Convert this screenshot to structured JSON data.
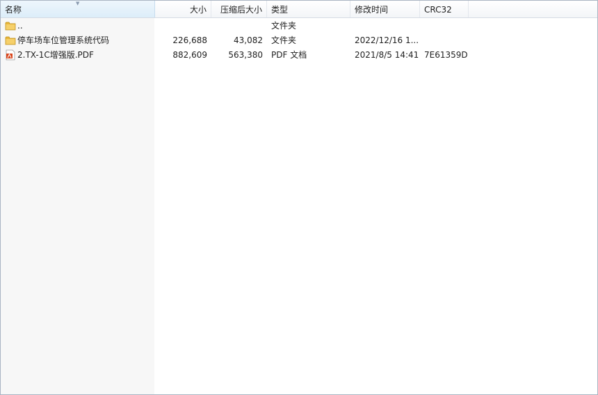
{
  "columns": {
    "name": "名称",
    "size": "大小",
    "packed": "压缩后大小",
    "type": "类型",
    "modified": "修改时间",
    "crc": "CRC32"
  },
  "rows": [
    {
      "name": "..",
      "size": "",
      "packed": "",
      "type": "文件夹",
      "modified": "",
      "crc": "",
      "icon": "folder-icon"
    },
    {
      "name": "停车场车位管理系统代码",
      "size": "226,688",
      "packed": "43,082",
      "type": "文件夹",
      "modified": "2022/12/16 1...",
      "crc": "",
      "icon": "folder-icon"
    },
    {
      "name": "2.TX-1C增强版.PDF",
      "size": "882,609",
      "packed": "563,380",
      "type": "PDF 文档",
      "modified": "2021/8/5 14:41",
      "crc": "7E61359D",
      "icon": "pdf-file-icon"
    }
  ],
  "colors": {
    "folder": "#e8b73a",
    "pdf": "#d9461c",
    "sorted_header": "#dcedf9"
  }
}
